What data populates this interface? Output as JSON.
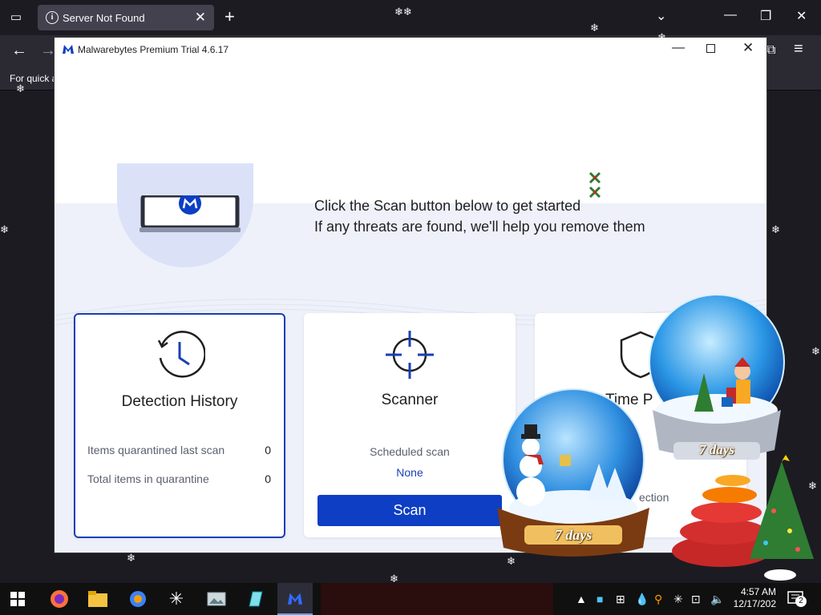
{
  "browser": {
    "tab_title": "Server Not Found",
    "tab_close": "✕",
    "new_tab": "+",
    "bookmarks_hint": "For quick a",
    "window_controls": [
      "—",
      "❐",
      "✕"
    ]
  },
  "app": {
    "title": "Malwarebytes Premium Trial 4.6.17",
    "window_controls": {
      "minimize": "—",
      "close": "✕"
    },
    "hero": {
      "line1": "Click the Scan button below to get started",
      "line2": "If any threats are found, we'll help you remove them"
    },
    "cards": {
      "detection_history": {
        "title": "Detection History",
        "stats": [
          {
            "label": "Items quarantined last scan",
            "value": "0"
          },
          {
            "label": "Total items in quarantine",
            "value": "0"
          }
        ]
      },
      "scanner": {
        "title": "Scanner",
        "scheduled_label": "Scheduled scan",
        "scheduled_value": "None",
        "scan_button": "Scan"
      },
      "real_time": {
        "title": "Time P",
        "subtext": "ection"
      }
    },
    "colors": {
      "accent": "#0d3ec4",
      "card_border_selected": "#1a3fb5"
    }
  },
  "decorations": {
    "globe_left_label": "7 days",
    "globe_right_label": "7 days"
  },
  "taskbar": {
    "clock_time": "4:57 AM",
    "clock_date": "12/17/202",
    "notification_count": "2",
    "pinned": [
      "windows-start-icon",
      "firefox-icon",
      "file-explorer-icon",
      "app-icon",
      "snowflake-app-icon",
      "photos-icon",
      "notepad-icon",
      "malwarebytes-icon"
    ]
  }
}
